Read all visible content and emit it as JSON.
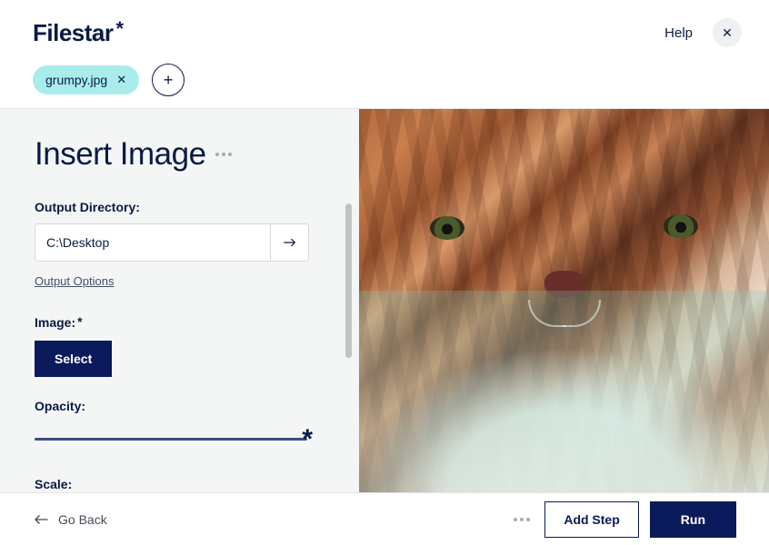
{
  "header": {
    "app_name": "Filestar",
    "help_label": "Help",
    "file_pill": "grumpy.jpg"
  },
  "main": {
    "title": "Insert Image",
    "output_directory_label": "Output Directory:",
    "output_directory_value": "C:\\Desktop",
    "output_options_label": "Output Options",
    "image_label": "Image:",
    "select_button": "Select",
    "opacity_label": "Opacity:",
    "scale_label": "Scale:"
  },
  "footer": {
    "back_label": "Go Back",
    "add_step_label": "Add Step",
    "run_label": "Run"
  }
}
